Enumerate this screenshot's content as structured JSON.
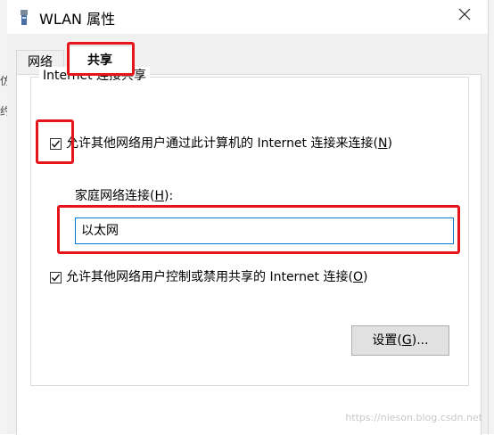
{
  "window": {
    "title": "WLAN 属性"
  },
  "background": {
    "left_glyphs": [
      "仿",
      "约"
    ]
  },
  "tabs": [
    {
      "label": "网络",
      "active": false
    },
    {
      "label": "共享",
      "active": true
    }
  ],
  "sharing": {
    "group_title": "Internet 连接共享",
    "allow_share": {
      "label_prefix": "允许其他网络用户通过此计算机的 Internet 连接来连接(",
      "mnemonic": "N",
      "label_suffix": ")",
      "checked": true
    },
    "home_network": {
      "label_prefix": "家庭网络连接(",
      "mnemonic": "H",
      "label_suffix": "):",
      "value": "以太网"
    },
    "allow_control": {
      "label_prefix": "允许其他网络用户控制或禁用共享的 Internet 连接(",
      "mnemonic": "O",
      "label_suffix": ")",
      "checked": true
    },
    "settings_button": {
      "label_prefix": "设置(",
      "mnemonic": "G",
      "label_suffix": ")..."
    }
  },
  "watermark": "https://nieson.blog.csdn.net",
  "colors": {
    "highlight": "#e8141a",
    "input_border": "#0078d7",
    "dialog_bg": "#f0f0f0"
  },
  "icons": {
    "title": "wifi-adapter-icon",
    "close": "close-icon",
    "check": "checkmark-icon"
  }
}
